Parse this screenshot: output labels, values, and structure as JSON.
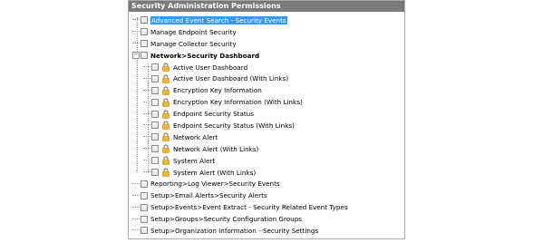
{
  "panel": {
    "title": "Security Administration Permissions"
  },
  "tree": {
    "items": [
      {
        "label": "Advanced Event Search - Security Events",
        "selected": true
      },
      {
        "label": "Manage Endpoint Security"
      },
      {
        "label": "Manage Collector Security"
      },
      {
        "label": "Network>Security Dashboard",
        "expander": "−",
        "bold": true
      },
      {
        "label": "Active User Dashboard",
        "icon": "lock-icon"
      },
      {
        "label": "Active User Dashboard (With Links)",
        "icon": "lock-icon"
      },
      {
        "label": "Encryption Key Information",
        "icon": "lock-icon"
      },
      {
        "label": "Encryption Key Information (With Links)",
        "icon": "lock-icon"
      },
      {
        "label": "Endpoint Security Status",
        "icon": "lock-icon"
      },
      {
        "label": "Endpoint Security Status (With Links)",
        "icon": "lock-icon"
      },
      {
        "label": "Network Alert",
        "icon": "lock-icon"
      },
      {
        "label": "Network Alert (With Links)",
        "icon": "lock-icon"
      },
      {
        "label": "System Alert",
        "icon": "lock-icon"
      },
      {
        "label": "System Alert (With Links)",
        "icon": "lock-icon"
      },
      {
        "label": "Reporting>Log Viewer>Security Events"
      },
      {
        "label": "Setup>Email Alerts>Security Alerts"
      },
      {
        "label": "Setup>Events>Event Extract - Security Related Event Types"
      },
      {
        "label": "Setup>Groups>Security Configuration Groups"
      },
      {
        "label": "Setup>Organization Information - Security Settings"
      }
    ]
  },
  "colors": {
    "header_bg": "#7a7a7a",
    "selection": "#3399ff",
    "lock_body": "#f2b632"
  }
}
